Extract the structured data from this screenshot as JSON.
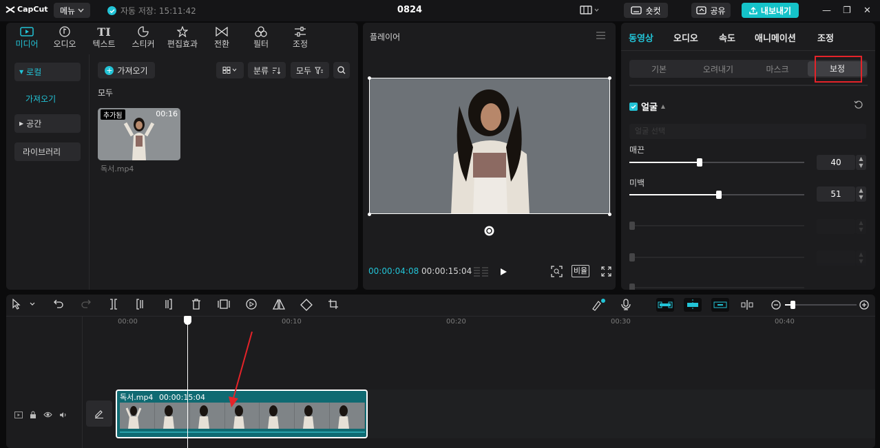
{
  "app": {
    "logo": "CapCut",
    "menu_label": "메뉴",
    "autosave": "자동 저장: 15:11:42",
    "project_title": "0824",
    "shortcut_label": "숏컷",
    "share_label": "공유",
    "export_label": "내보내기"
  },
  "media": {
    "tabs": [
      {
        "label": "미디어",
        "icon": "media-icon"
      },
      {
        "label": "오디오",
        "icon": "audio-icon"
      },
      {
        "label": "텍스트",
        "icon": "text-icon"
      },
      {
        "label": "스티커",
        "icon": "sticker-icon"
      },
      {
        "label": "편집효과",
        "icon": "effects-icon"
      },
      {
        "label": "전환",
        "icon": "transition-icon"
      },
      {
        "label": "필터",
        "icon": "filter-icon"
      },
      {
        "label": "조정",
        "icon": "adjust-icon"
      }
    ],
    "sidebar": {
      "local": "로컬",
      "import_sub": "가져오기",
      "space": "공간",
      "library": "라이브러리"
    },
    "import_button": "가져오기",
    "sort_label": "분류",
    "filter_label": "모두",
    "section_label": "모두",
    "clip": {
      "badge": "추가됨",
      "duration": "00:16",
      "filename": "독서.mp4"
    }
  },
  "player": {
    "title": "플레이어",
    "current_time": "00:00:04:08",
    "total_time": "00:00:15:04",
    "ratio_label": "비율"
  },
  "props": {
    "tabs": [
      "동영상",
      "오디오",
      "속도",
      "애니메이션",
      "조정"
    ],
    "active_tab": 0,
    "subtabs": [
      "기본",
      "오려내기",
      "마스크",
      "보정"
    ],
    "active_subtab": 3,
    "face_section": "얼굴",
    "dropdown_placeholder": "얼굴 선택",
    "sliders": [
      {
        "label": "매끈",
        "value": "40",
        "fraction": 0.4
      },
      {
        "label": "미백",
        "value": "51",
        "fraction": 0.51
      }
    ]
  },
  "timeline": {
    "ruler": [
      "00:00",
      "00:10",
      "00:20",
      "00:30",
      "00:40"
    ],
    "clip_name": "독서.mp4",
    "clip_duration": "00:00:15:04"
  },
  "colors": {
    "accent": "#22c3d6",
    "export": "#15c3c9",
    "highlight_box": "#e52329",
    "clip_track": "#0f6a72"
  }
}
